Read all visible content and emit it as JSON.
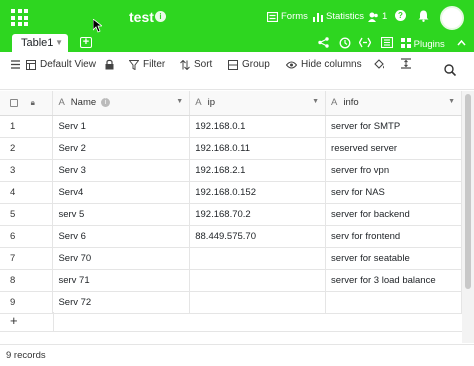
{
  "header": {
    "base_title": "test",
    "forms_label": "Forms",
    "statistics_label": "Statistics",
    "collaborators_count": "1"
  },
  "tabs": {
    "active_tab_label": "Table1"
  },
  "view_tools": {
    "plugins_label": "Plugins"
  },
  "toolbar": {
    "view_label": "Default View",
    "filter_label": "Filter",
    "sort_label": "Sort",
    "group_label": "Group",
    "hide_columns_label": "Hide columns"
  },
  "table": {
    "columns": [
      {
        "name": "Name",
        "type_icon": "A"
      },
      {
        "name": "ip",
        "type_icon": "A"
      },
      {
        "name": "info",
        "type_icon": "A"
      }
    ],
    "rows": [
      {
        "num": "1",
        "name": "Serv 1",
        "ip": "192.168.0.1",
        "info": "server for SMTP"
      },
      {
        "num": "2",
        "name": "Serv 2",
        "ip": "192.168.0.11",
        "info": "reserved server"
      },
      {
        "num": "3",
        "name": "Serv 3",
        "ip": "192.168.2.1",
        "info": "server fro vpn"
      },
      {
        "num": "4",
        "name": "Serv4",
        "ip": "192.168.0.152",
        "info": "serv for NAS"
      },
      {
        "num": "5",
        "name": "serv 5",
        "ip": "192.168.70.2",
        "info": "server for backend"
      },
      {
        "num": "6",
        "name": "Serv 6",
        "ip": "88.449.575.70",
        "info": "serv for frontend"
      },
      {
        "num": "7",
        "name": "Serv 70",
        "ip": "",
        "info": "server for seatable"
      },
      {
        "num": "8",
        "name": "serv 71",
        "ip": "",
        "info": "server for 3 load balance"
      },
      {
        "num": "9",
        "name": "Serv 72",
        "ip": "",
        "info": ""
      }
    ],
    "add_row_symbol": "+"
  },
  "footer": {
    "record_count": "9 records"
  },
  "colors": {
    "brand_green": "#2ed620"
  }
}
